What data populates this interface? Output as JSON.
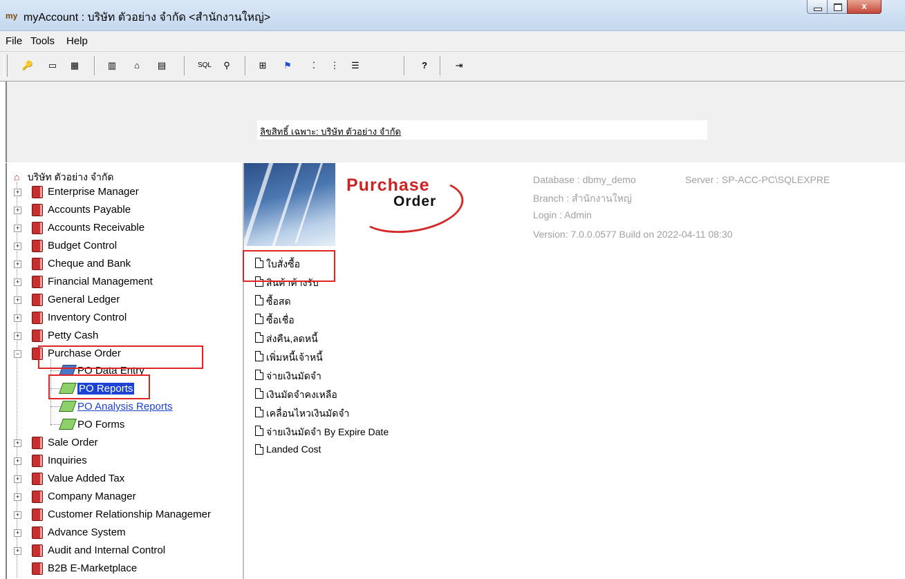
{
  "window": {
    "app_icon": "my",
    "title": "myAccount : บริษัท ตัวอย่าง จำกัด <สำนักงานใหญ่>",
    "close_glyph": "x"
  },
  "menu": [
    "File",
    "Tools",
    "Help"
  ],
  "toolbar": {
    "buttons": [
      {
        "icon": "key-icon",
        "glyph": "🔑"
      },
      {
        "icon": "window-icon",
        "glyph": "▭"
      },
      {
        "icon": "grid-icon",
        "glyph": "▦"
      },
      {
        "icon": "calendar-icon",
        "glyph": "▥"
      },
      {
        "icon": "home-icon",
        "glyph": "⌂"
      },
      {
        "icon": "calculator-icon",
        "glyph": "▤"
      },
      {
        "icon": "sql-icon",
        "glyph": "SQL"
      },
      {
        "icon": "search-user-icon",
        "glyph": "⚲"
      },
      {
        "icon": "table-icon",
        "glyph": "⊞"
      },
      {
        "icon": "flag-icon",
        "glyph": "⚑"
      },
      {
        "icon": "align-icon",
        "glyph": "⁚"
      },
      {
        "icon": "tree-layout-icon",
        "glyph": "⋮"
      },
      {
        "icon": "list-icon",
        "glyph": "☰"
      },
      {
        "icon": "help-icon",
        "glyph": "?"
      },
      {
        "icon": "exit-icon",
        "glyph": "⇥"
      }
    ]
  },
  "banner": {
    "license_text": "ลิขสิทธิ์ เฉพาะ: บริษัท ตัวอย่าง จำกัด"
  },
  "tree": {
    "root": "บริษัท ตัวอย่าง จำกัด",
    "modules": [
      "Enterprise Manager",
      "Accounts Payable",
      "Accounts Receivable",
      "Budget Control",
      "Cheque and Bank",
      "Financial Management",
      "General Ledger",
      "Inventory Control",
      "Petty Cash",
      "Purchase Order"
    ],
    "po_children": [
      "PO Data Entry",
      "PO Reports",
      "PO Analysis Reports",
      "PO Forms"
    ],
    "modules_after": [
      "Sale Order",
      "Inquiries",
      "Value Added Tax",
      "Company Manager",
      "Customer Relationship Managemer",
      "Advance System",
      "Audit and Internal Control",
      "B2B E-Marketplace"
    ],
    "expand_glyph": "+",
    "collapse_glyph": "−"
  },
  "main": {
    "logo_purchase": "Purchase",
    "logo_order": "Order",
    "info": {
      "database": "Database :  dbmy_demo",
      "server": "Server : SP-ACC-PC\\SQLEXPRE",
      "branch": "Branch :     สำนักงานใหญ่",
      "login": "Login :        Admin",
      "version": "Version: 7.0.0.0577  Build on 2022-04-11 08:30"
    },
    "reports": [
      "ใบสั่งซื้อ",
      "สินค้าค้างรับ",
      "ซื้อสด",
      "ซื้อเชื่อ",
      "ส่งคืน,ลดหนี้",
      "เพิ่มหนี้เจ้าหนี้",
      "จ่ายเงินมัดจำ",
      "เงินมัดจำคงเหลือ",
      "เคลื่อนไหวเงินมัดจำ",
      "จ่ายเงินมัดจำ  By Expire Date",
      "Landed Cost"
    ]
  }
}
